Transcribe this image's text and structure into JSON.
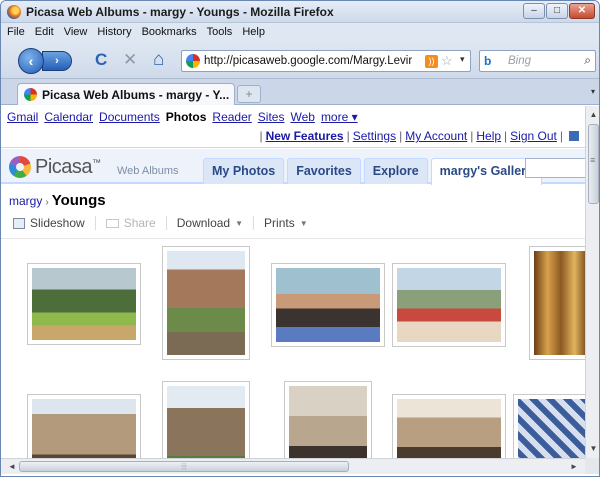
{
  "window": {
    "title": "Picasa Web Albums - margy - Youngs - Mozilla Firefox",
    "buttons": {
      "minimize": "–",
      "maximize": "□",
      "close": "✕"
    }
  },
  "menu": [
    {
      "label": "File",
      "key": "F"
    },
    {
      "label": "Edit",
      "key": "E"
    },
    {
      "label": "View",
      "key": "V"
    },
    {
      "label": "History",
      "key": "s"
    },
    {
      "label": "Bookmarks",
      "key": "B"
    },
    {
      "label": "Tools",
      "key": "T"
    },
    {
      "label": "Help",
      "key": "H"
    }
  ],
  "nav": {
    "back": "‹",
    "forward": "›",
    "reload": "C",
    "stop": "✕",
    "home": "⌂",
    "url": "http://picasaweb.google.com/Margy.Levin",
    "url_display": "http://picasaweb.google.com/Margy.Levir",
    "rss": "))",
    "star": "☆",
    "dropdown": "▾",
    "search_engine": "b",
    "search_placeholder": "Bing",
    "search_icon": "⌕"
  },
  "tabs": [
    {
      "label": "Picasa Web Albums - margy - Y..."
    }
  ],
  "new_tab": "+",
  "google_bar": {
    "links": [
      "Gmail",
      "Calendar",
      "Documents"
    ],
    "current": "Photos",
    "links2": [
      "Reader",
      "Sites",
      "Web"
    ],
    "more": "more ▾"
  },
  "user_links": [
    "New Features",
    "Settings",
    "My Account",
    "Help",
    "Sign Out"
  ],
  "picasa": {
    "logo": "Picasa",
    "tm": "™",
    "sub": "Web Albums",
    "tabs": [
      "My Photos",
      "Favorites",
      "Explore",
      "margy's Gallery"
    ],
    "active_tab": "margy's Gallery"
  },
  "breadcrumb": {
    "user": "margy",
    "separator": "›",
    "album": "Youngs"
  },
  "actions": [
    {
      "label": "Slideshow",
      "enabled": true
    },
    {
      "label": "Share",
      "enabled": false
    },
    {
      "label": "Download",
      "enabled": true
    },
    {
      "label": "Prints",
      "enabled": true
    }
  ],
  "photos": [
    {
      "subject": "park-garden-trees"
    },
    {
      "subject": "woman-in-front-of-stone-tower"
    },
    {
      "subject": "two-women-smiling"
    },
    {
      "subject": "group-at-outdoor-cafe"
    },
    {
      "subject": "ornate-gold-altar"
    },
    {
      "subject": "plateresque-facade"
    },
    {
      "subject": "stone-tower-and-gate"
    },
    {
      "subject": "carved-stone-doorway"
    },
    {
      "subject": "cloister-arcade"
    },
    {
      "subject": "tiled-wall-detail"
    }
  ]
}
